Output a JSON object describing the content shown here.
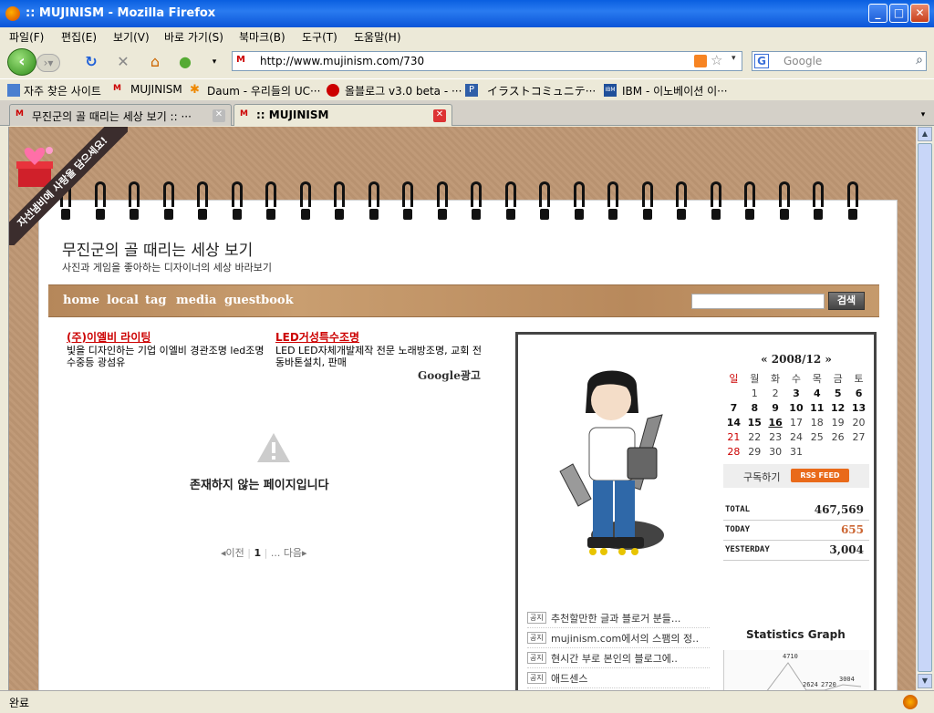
{
  "window": {
    "title": ":: MUJINISM - Mozilla Firefox"
  },
  "menu": [
    "파일(F)",
    "편집(E)",
    "보기(V)",
    "바로 가기(S)",
    "북마크(B)",
    "도구(T)",
    "도움말(H)"
  ],
  "nav": {
    "url": "http://www.mujinism.com/730",
    "search_placeholder": "Google"
  },
  "bookmarks": [
    "자주 찾은 사이트",
    "MUJINISM",
    "Daum - 우리들의 UC···",
    "올블로그 v3.0 beta - ···",
    "イラストコミュニテ···",
    "IBM - 이노베이션 이···"
  ],
  "tabs": [
    {
      "label": "무진군의 골 때리는 세상 보기 :: ···",
      "active": false
    },
    {
      "label": ":: MUJINISM",
      "active": true
    }
  ],
  "page": {
    "ribbon": "자선냄비에 사랑을 담으세요!",
    "title": "무진군의 골 때리는 세상 보기",
    "subtitle": "사진과 게임을 좋아하는 디자이너의 세상 바라보기",
    "nav_links": [
      "home",
      "local",
      "tag",
      "media",
      "guestbook"
    ],
    "search_button": "검색",
    "ads": [
      {
        "head": "(주)이엘비 라이팅",
        "body": "빛을 디자인하는 기업 이엘비 경관조명 led조명 수중등 광섬유"
      },
      {
        "head": "LED거성특수조명",
        "body": "LED LED자체개발제작 전문 노래방조명, 교회 전동바톤설치, 판매"
      }
    ],
    "google_ad": "Google광고",
    "not_found": "존재하지 않는 페이지입니다",
    "pager": {
      "prev": "◂이전",
      "current": "1",
      "next": "... 다음▸"
    }
  },
  "sidebar": {
    "calendar": {
      "caption": "«  2008/12  »",
      "weekdays": [
        "일",
        "월",
        "화",
        "수",
        "목",
        "금",
        "토"
      ],
      "weeks": [
        [
          "",
          "1",
          "2",
          "3",
          "4",
          "5",
          "6"
        ],
        [
          "7",
          "8",
          "9",
          "10",
          "11",
          "12",
          "13"
        ],
        [
          "14",
          "15",
          "16",
          "17",
          "18",
          "19",
          "20"
        ],
        [
          "21",
          "22",
          "23",
          "24",
          "25",
          "26",
          "27"
        ],
        [
          "28",
          "29",
          "30",
          "31",
          "",
          "",
          ""
        ]
      ]
    },
    "subscribe_label": "구독하기",
    "rss_label": "RSS FEED",
    "stats": [
      {
        "key": "TOTAL",
        "value": "467,569"
      },
      {
        "key": "TODAY",
        "value": "655"
      },
      {
        "key": "YESTERDAY",
        "value": "3,004"
      }
    ],
    "notice_tag": "공지",
    "notices": [
      "추천할만한 글과 블로거 분들...",
      "mujinism.com에서의 스팸의 정..",
      "현시간 부로 본인의 블로그에..",
      "애드센스"
    ],
    "graph_title": "Statistics Graph",
    "graph_values": [
      "4710",
      "2624",
      "2720",
      "3004"
    ]
  },
  "status": {
    "text": "완료"
  }
}
